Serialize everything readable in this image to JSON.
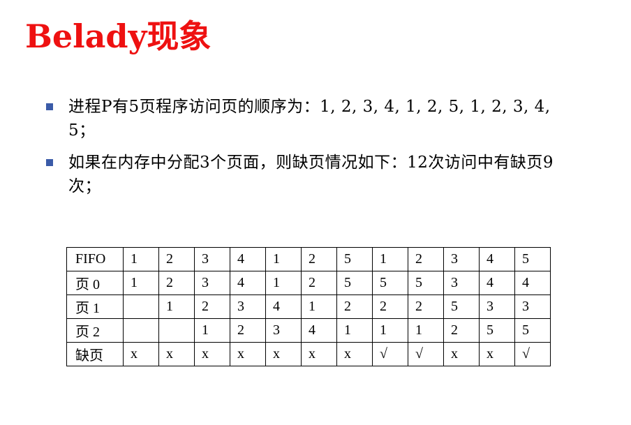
{
  "title": "Belady现象",
  "bullets": [
    "进程P有5页程序访问页的顺序为：1, 2, 3, 4, 1, 2, 5, 1, 2, 3, 4, 5；",
    "如果在内存中分配3个页面，则缺页情况如下：12次访问中有缺页9次；"
  ],
  "table": {
    "rows": [
      {
        "label": "FIFO",
        "cells": [
          "1",
          "2",
          "3",
          "4",
          "1",
          "2",
          "5",
          "1",
          "2",
          "3",
          "4",
          "5"
        ]
      },
      {
        "label": "页 0",
        "cells": [
          "1",
          "2",
          "3",
          "4",
          "1",
          "2",
          "5",
          "5",
          "5",
          "3",
          "4",
          "4"
        ]
      },
      {
        "label": "页 1",
        "cells": [
          "",
          "1",
          "2",
          "3",
          "4",
          "1",
          "2",
          "2",
          "2",
          "5",
          "3",
          "3"
        ]
      },
      {
        "label": "页 2",
        "cells": [
          "",
          "",
          "1",
          "2",
          "3",
          "4",
          "1",
          "1",
          "1",
          "2",
          "5",
          "5"
        ]
      },
      {
        "label": "缺页",
        "cells": [
          "x",
          "x",
          "x",
          "x",
          "x",
          "x",
          "x",
          "√",
          "√",
          "x",
          "x",
          "√"
        ]
      }
    ]
  }
}
